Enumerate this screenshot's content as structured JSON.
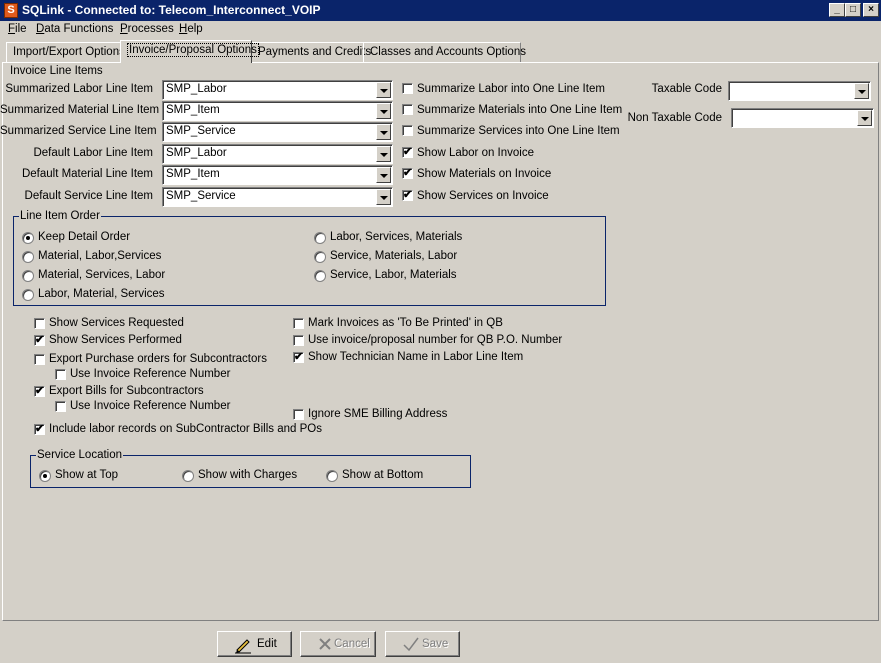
{
  "window": {
    "title": "SQLink - Connected to: Telecom_Interconnect_VOIP",
    "app_icon": "S",
    "minimize": "_",
    "maximize": "□",
    "close": "×"
  },
  "menu": [
    "File",
    "Data Functions",
    "Processes",
    "Help"
  ],
  "tabs": [
    "Import/Export Options",
    "Invoice/Proposal Options",
    "Payments and Credits",
    "Classes and Accounts Options"
  ],
  "invoice_line_items": {
    "title": "Invoice Line Items",
    "rows": [
      {
        "label": "Summarized Labor Line Item",
        "value": "SMP_Labor",
        "check_label": "Summarize Labor into One Line Item",
        "checked": false
      },
      {
        "label": "Summarized Material Line Item",
        "value": "SMP_Item",
        "check_label": "Summarize Materials into One Line Item",
        "checked": false
      },
      {
        "label": "Summarized Service Line Item",
        "value": "SMP_Service",
        "check_label": "Summarize Services into One Line Item",
        "checked": false
      },
      {
        "label": "Default Labor Line Item",
        "value": "SMP_Labor",
        "check_label": "Show Labor on Invoice",
        "checked": true
      },
      {
        "label": "Default Material Line Item",
        "value": "SMP_Item",
        "check_label": "Show Materials on Invoice",
        "checked": true
      },
      {
        "label": "Default Service Line Item",
        "value": "SMP_Service",
        "check_label": "Show Services on Invoice",
        "checked": true
      }
    ]
  },
  "tax": {
    "taxable_label": "Taxable Code",
    "taxable_value": "",
    "non_taxable_label": "Non Taxable Code",
    "non_taxable_value": ""
  },
  "line_item_order": {
    "title": "Line Item Order",
    "options": [
      {
        "label": "Keep Detail Order",
        "selected": true
      },
      {
        "label": "Material, Labor,Services",
        "selected": false
      },
      {
        "label": "Material, Services, Labor",
        "selected": false
      },
      {
        "label": "Labor, Material, Services",
        "selected": false
      },
      {
        "label": "Labor, Services, Materials",
        "selected": false
      },
      {
        "label": "Service, Materials, Labor",
        "selected": false
      },
      {
        "label": "Service, Labor, Materials",
        "selected": false
      }
    ]
  },
  "options_left": [
    {
      "label": "Show Services Requested",
      "checked": false
    },
    {
      "label": "Show Services Performed",
      "checked": true
    },
    {
      "label": "Export Purchase orders for Subcontractors",
      "checked": false
    },
    {
      "label": "Use Invoice Reference Number",
      "checked": false
    },
    {
      "label": "Export Bills for Subcontractors",
      "checked": true
    },
    {
      "label": "Use Invoice Reference Number",
      "checked": false
    },
    {
      "label": "Include labor records on SubContractor Bills and POs",
      "checked": true
    }
  ],
  "options_right": [
    {
      "label": "Mark Invoices as 'To Be Printed' in QB",
      "checked": false
    },
    {
      "label": "Use invoice/proposal number for QB P.O. Number",
      "checked": false
    },
    {
      "label": "Show Technician Name in Labor Line Item",
      "checked": true
    },
    {
      "label": "Ignore SME Billing Address",
      "checked": false
    }
  ],
  "service_location": {
    "title": "Service Location",
    "options": [
      {
        "label": "Show at Top",
        "selected": true
      },
      {
        "label": "Show with Charges",
        "selected": false
      },
      {
        "label": "Show at Bottom",
        "selected": false
      }
    ]
  },
  "buttons": {
    "edit": "Edit",
    "cancel": "Cancel",
    "save": "Save"
  },
  "check_glyph": "✔"
}
